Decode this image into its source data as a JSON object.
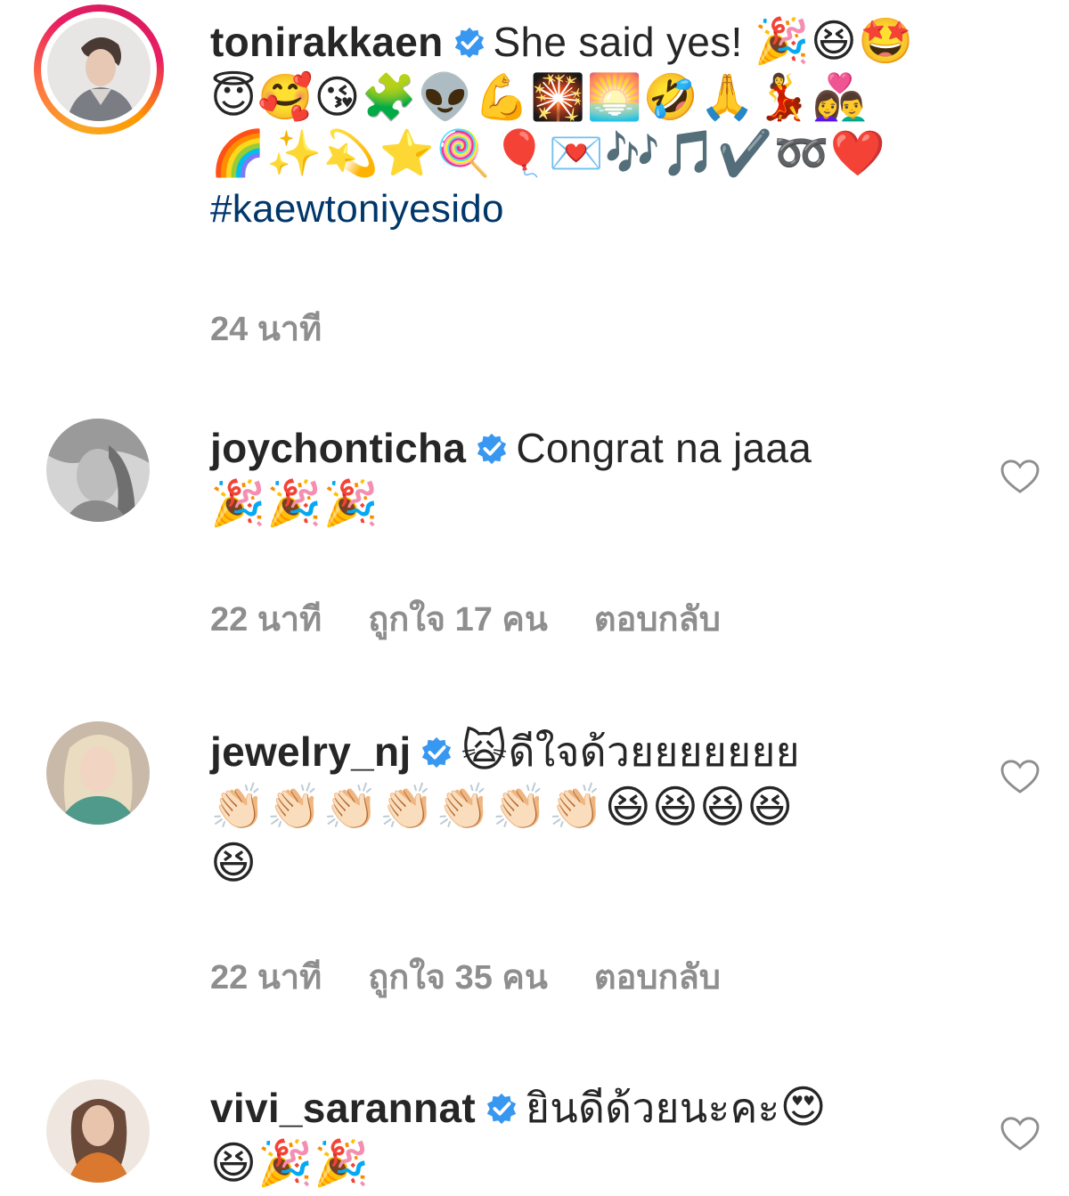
{
  "comments": [
    {
      "username": "tonirakkaen",
      "verified": true,
      "text": "She said yes!",
      "emojis_line1": "🎉😆🤩",
      "emojis_line2": "😇🥰😘🧩👽💪🎇🌅🤣🙏💃👩‍❤️‍👨",
      "emojis_line3": "🌈✨💫⭐🍭🎈💌🎶🎵✔️➿❤️",
      "hashtag": "#kaewtoniyesido",
      "time": "24 นาที"
    },
    {
      "username": "joychonticha",
      "verified": true,
      "text": "Congrat na jaaa",
      "emojis_line1": "🎉🎉🎉",
      "time": "22 นาที",
      "likes": "ถูกใจ 17 คน",
      "reply": "ตอบกลับ"
    },
    {
      "username": "jewelry_nj",
      "verified": true,
      "emoji_prefix": "🙀",
      "text": "ดีใจด้วยยยยยยย",
      "emojis_line1": "👏🏻👏🏻👏🏻👏🏻👏🏻👏🏻👏🏻😆😆😆😆",
      "emojis_line2": "😆",
      "time": "22 นาที",
      "likes": "ถูกใจ 35 คน",
      "reply": "ตอบกลับ"
    },
    {
      "username": "vivi_sarannat",
      "verified": true,
      "text": "ยินดีด้วยนะคะ",
      "emoji_suffix": "😍",
      "emojis_line1": "😆🎉🎉"
    }
  ],
  "colors": {
    "text": "#262626",
    "meta": "#8e8e8e",
    "verified": "#3897f0",
    "hashtag": "#00376b"
  },
  "icons": {
    "verified": "verified-badge-icon",
    "like": "heart-outline-icon"
  }
}
